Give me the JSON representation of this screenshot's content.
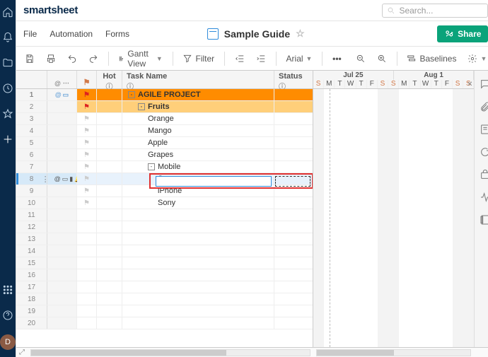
{
  "brand": "smartsheet",
  "search": {
    "placeholder": "Search..."
  },
  "menus": [
    "File",
    "Automation",
    "Forms"
  ],
  "doc": {
    "title": "Sample Guide"
  },
  "share": "Share",
  "toolbar": {
    "view_label": "Gantt View",
    "filter_label": "Filter",
    "font_label": "Arial",
    "baselines_label": "Baselines"
  },
  "columns": {
    "hot": "Hot",
    "task": "Task Name",
    "status": "Status"
  },
  "gantt": {
    "months": [
      "Jul 25",
      "Aug 1"
    ],
    "days": [
      "S",
      "M",
      "T",
      "W",
      "T",
      "F",
      "S",
      "S",
      "M",
      "T",
      "W",
      "T",
      "F",
      "S",
      "S"
    ]
  },
  "rows": [
    {
      "n": 1,
      "level": 0,
      "label": "AGILE PROJECT",
      "flag": "red",
      "exp": "-",
      "ind": [
        "@",
        "chat"
      ]
    },
    {
      "n": 2,
      "level": 1,
      "label": "Fruits",
      "flag": "red",
      "exp": "-"
    },
    {
      "n": 3,
      "level": 2,
      "label": "Orange",
      "flag": "grey"
    },
    {
      "n": 4,
      "level": 2,
      "label": "Mango",
      "flag": "grey"
    },
    {
      "n": 5,
      "level": 2,
      "label": "Apple",
      "flag": "grey"
    },
    {
      "n": 6,
      "level": 2,
      "label": "Grapes",
      "flag": "grey"
    },
    {
      "n": 7,
      "level": 2,
      "label": "Mobile",
      "flag": "grey",
      "exp": "-"
    },
    {
      "n": 8,
      "level": 3,
      "label": "Samsung",
      "flag": "grey",
      "sel": true,
      "ind": [
        "@",
        "chat",
        "case",
        "bell"
      ]
    },
    {
      "n": 9,
      "level": 3,
      "label": "iPhone",
      "flag": "grey"
    },
    {
      "n": 10,
      "level": 3,
      "label": "Sony",
      "flag": "grey"
    },
    {
      "n": 11
    },
    {
      "n": 12
    },
    {
      "n": 13
    },
    {
      "n": 14
    },
    {
      "n": 15
    },
    {
      "n": 16
    },
    {
      "n": 17
    },
    {
      "n": 18
    },
    {
      "n": 19
    },
    {
      "n": 20
    }
  ],
  "avatar": "D"
}
